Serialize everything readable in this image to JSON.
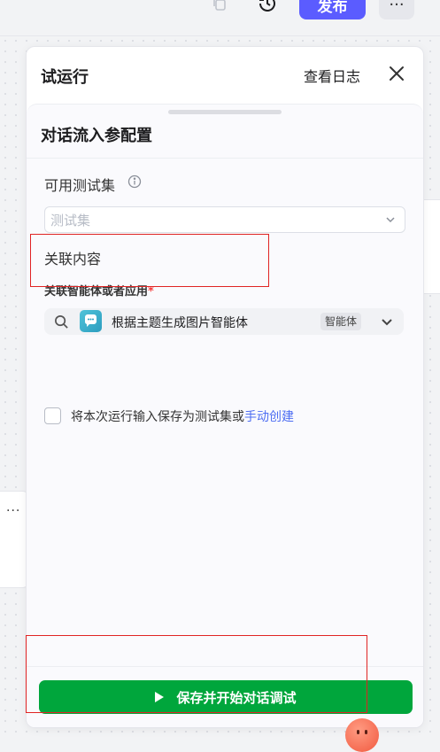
{
  "toolbar": {
    "publish_label": "发布",
    "more_label": "···"
  },
  "panel": {
    "title": "试运行",
    "log_link": "查看日志"
  },
  "config": {
    "title": "对话流入参配置",
    "testset_label": "可用测试集",
    "testset_placeholder": "测试集",
    "related_label": "关联内容",
    "agent_label": "关联智能体或者应用",
    "agent_required_mark": "*",
    "agent_name": "根据主题生成图片智能体",
    "agent_badge": "智能体",
    "save_text": "将本次运行输入保存为测试集或",
    "save_link": "手动创建"
  },
  "footer": {
    "run_button_label": "保存并开始对话调试"
  },
  "background": {
    "card_more": "···"
  },
  "colors": {
    "publish": "#5b5cff",
    "run_button": "#00a63c",
    "link": "#4e6ef2",
    "required": "#f53f3f",
    "highlight_box": "#e02424"
  },
  "icons": [
    "copy-icon",
    "history-icon",
    "close-icon",
    "info-icon",
    "chevron-down-icon",
    "search-icon",
    "chat-bubble-icon",
    "play-icon"
  ]
}
